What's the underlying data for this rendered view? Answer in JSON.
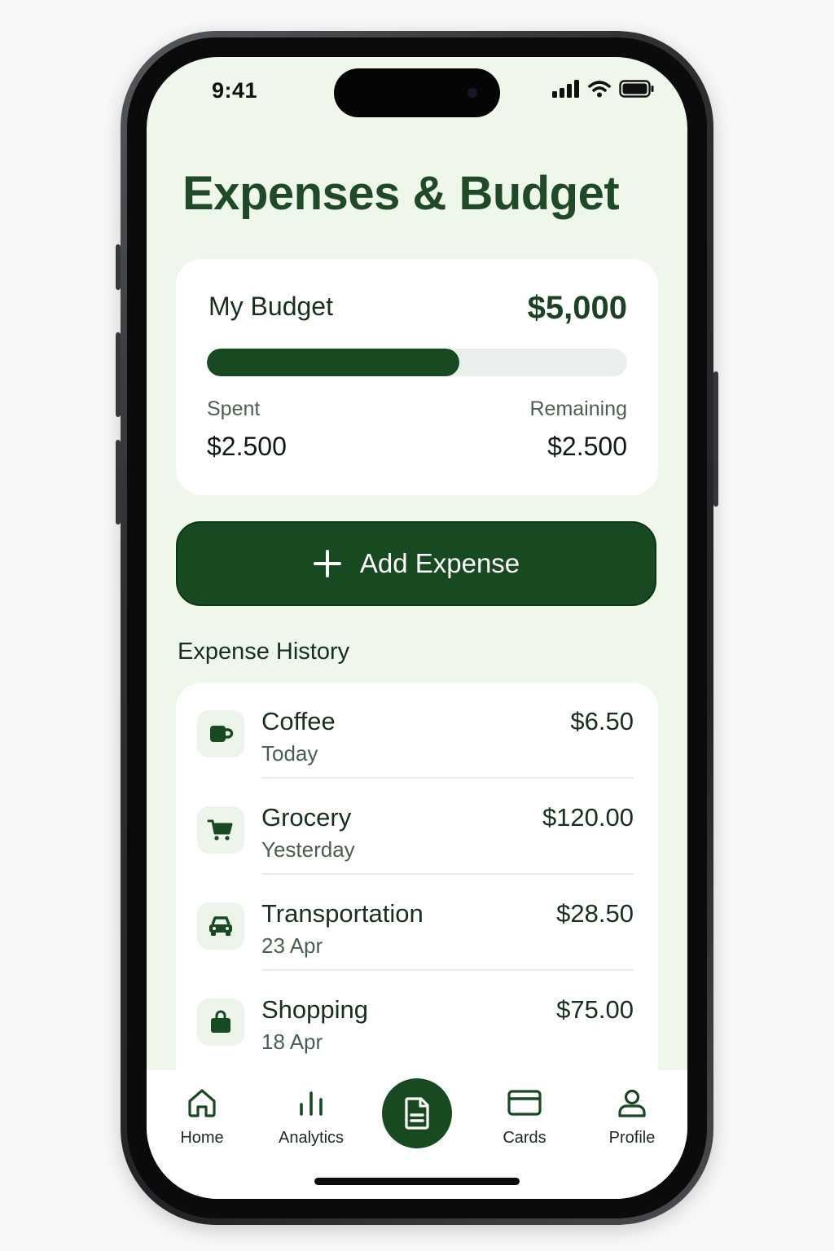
{
  "status_bar": {
    "time": "9:41",
    "icons": [
      "signal-icon",
      "wifi-icon",
      "battery-icon"
    ]
  },
  "header": {
    "title": "Expenses & Budget"
  },
  "budget": {
    "label": "My Budget",
    "total": "$5,000",
    "progress_percent": 60,
    "spent_label": "Spent",
    "spent_value": "$2.500",
    "remaining_label": "Remaining",
    "remaining_value": "$2.500"
  },
  "add_button": {
    "icon": "plus-icon",
    "label": "Add Expense"
  },
  "history": {
    "title": "Expense History",
    "items": [
      {
        "name": "Coffee",
        "date": "Today",
        "amount": "$6.50",
        "icon": "coffee-cup-icon"
      },
      {
        "name": "Grocery",
        "date": "Yesterday",
        "amount": "$120.00",
        "icon": "shopping-cart-icon"
      },
      {
        "name": "Transportation",
        "date": "23 Apr",
        "amount": "$28.50",
        "icon": "car-icon"
      },
      {
        "name": "Shopping",
        "date": "18 Apr",
        "amount": "$75.00",
        "icon": "shopping-bag-icon"
      }
    ]
  },
  "nav": {
    "items": [
      {
        "label": "Home",
        "icon": "home-icon"
      },
      {
        "label": "Analytics",
        "icon": "bar-chart-icon"
      },
      {
        "label": "",
        "icon": "document-icon"
      },
      {
        "label": "Cards",
        "icon": "credit-card-icon"
      },
      {
        "label": "Profile",
        "icon": "user-icon"
      }
    ]
  },
  "colors": {
    "primary": "#184a22",
    "background": "#eff7ea",
    "card": "#ffffff",
    "title": "#1e4a28"
  }
}
